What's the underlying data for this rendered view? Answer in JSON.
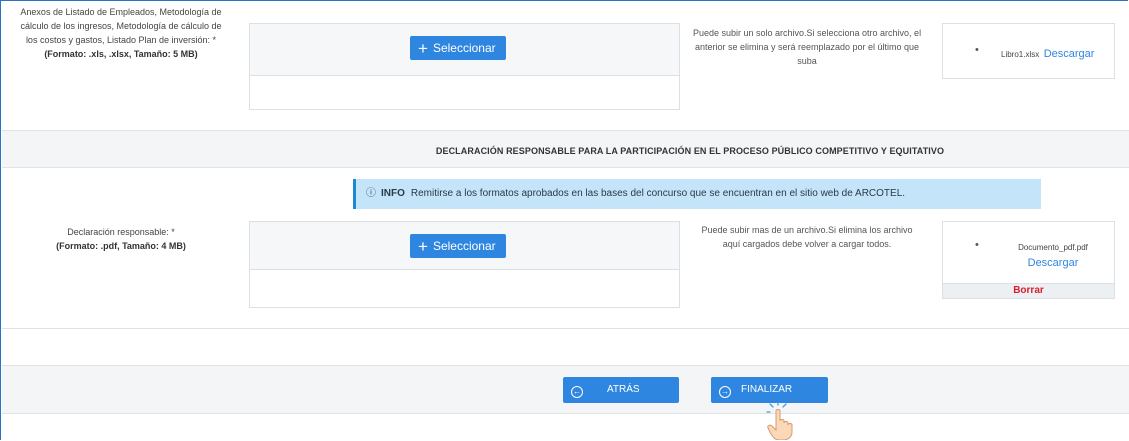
{
  "annexes": {
    "label": "Anexos de Listado de Empleados, Metodología de cálculo de los ingresos, Metodología de cálculo de los costos y gastos, Listado Plan de inversión: *",
    "format": "(Formato: .xls, .xlsx, Tamaño: 5 MB)",
    "select_label": "Seleccionar",
    "note": "Puede subir un solo archivo.Si selecciona otro archivo, el anterior se elimina y será reemplazado por el último que suba",
    "file": {
      "name": "Libro1.xlsx",
      "download": "Descargar"
    }
  },
  "declaration_section": {
    "title": "DECLARACIÓN RESPONSABLE PARA LA PARTICIPACIÓN EN EL PROCESO PÚBLICO COMPETITIVO Y EQUITATIVO",
    "info": {
      "label": "INFO",
      "text": "Remitirse a los formatos aprobados en las bases del concurso que se encuentran en el sitio web de ARCOTEL."
    },
    "label": "Declaración responsable: *",
    "format": "(Formato: .pdf, Tamaño: 4 MB)",
    "select_label": "Seleccionar",
    "note": "Puede subir mas de un archivo.Si elimina los archivo aquí cargados debe volver a cargar todos.",
    "file": {
      "name": "Documento_pdf.pdf",
      "download": "Descargar",
      "delete": "Borrar"
    }
  },
  "footer": {
    "back_label": "ATRÁS",
    "finish_label": "FINALIZAR"
  },
  "colors": {
    "primary": "#2f86e0",
    "info_bg": "#c3e4f9",
    "danger": "#d81e2c"
  },
  "icons": [
    "plus-icon",
    "info-circle-icon",
    "arrow-left-circle-icon",
    "arrow-right-circle-icon",
    "pointer-hand-icon"
  ]
}
